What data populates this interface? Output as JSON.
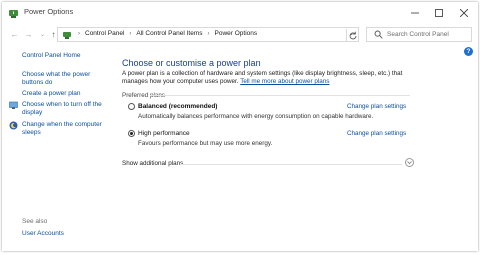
{
  "window": {
    "title": "Power Options"
  },
  "address_bar": {
    "crumbs": [
      "Control Panel",
      "All Control Panel Items",
      "Power Options"
    ],
    "search_placeholder": "Search Control Panel"
  },
  "sidebar": {
    "home": "Control Panel Home",
    "links": [
      "Choose what the power buttons do",
      "Create a power plan",
      "Choose when to turn off the display",
      "Change when the computer sleeps"
    ],
    "see_also_label": "See also",
    "see_also_links": [
      "User Accounts"
    ]
  },
  "main": {
    "heading": "Choose or customise a power plan",
    "intro": "A power plan is a collection of hardware and system settings (like display brightness, sleep, etc.) that manages how your computer uses power.",
    "intro_link": "Tell me more about power plans",
    "preferred_label": "Preferred plans",
    "plans": [
      {
        "name": "Balanced (recommended)",
        "description": "Automatically balances performance with energy consumption on capable hardware.",
        "change_label": "Change plan settings",
        "selected": false
      },
      {
        "name": "High performance",
        "description": "Favours performance but may use more energy.",
        "change_label": "Change plan settings",
        "selected": true
      }
    ],
    "show_additional": "Show additional plans"
  },
  "colors": {
    "link": "#0b4f9c",
    "heading": "#1a3f8a",
    "help": "#1d6fd6"
  }
}
